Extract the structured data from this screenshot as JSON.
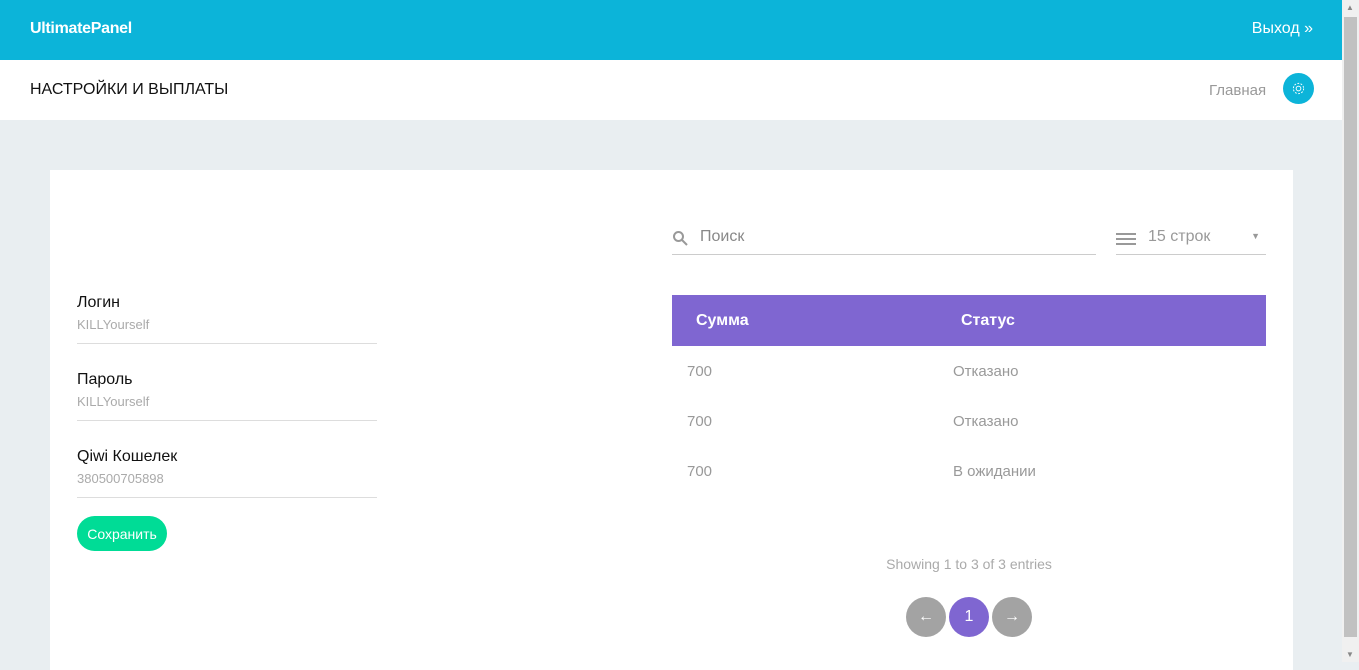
{
  "header": {
    "brand": "UltimatePanel",
    "logout": "Выход »"
  },
  "subheader": {
    "title": "НАСТРОЙКИ И ВЫПЛАТЫ",
    "home_link": "Главная",
    "settings_icon": "gear-icon"
  },
  "form": {
    "fields": [
      {
        "label": "Логин",
        "value": "KILLYourself"
      },
      {
        "label": "Пароль",
        "value": "KILLYourself"
      },
      {
        "label": "Qiwi Кошелек",
        "value": "380500705898"
      }
    ],
    "save_label": "Сохранить"
  },
  "table": {
    "search_placeholder": "Поиск",
    "rows_select": "15 строк",
    "columns": [
      "Сумма",
      "Статус"
    ],
    "rows": [
      [
        "700",
        "Отказано"
      ],
      [
        "700",
        "Отказано"
      ],
      [
        "700",
        "В ожидании"
      ]
    ],
    "info": "Showing 1 to 3 of 3 entries",
    "pagination": {
      "prev": "←",
      "current": "1",
      "next": "→"
    }
  },
  "colors": {
    "primary": "#0cb4d9",
    "accent": "#7f66d1",
    "success": "#00dc96"
  }
}
